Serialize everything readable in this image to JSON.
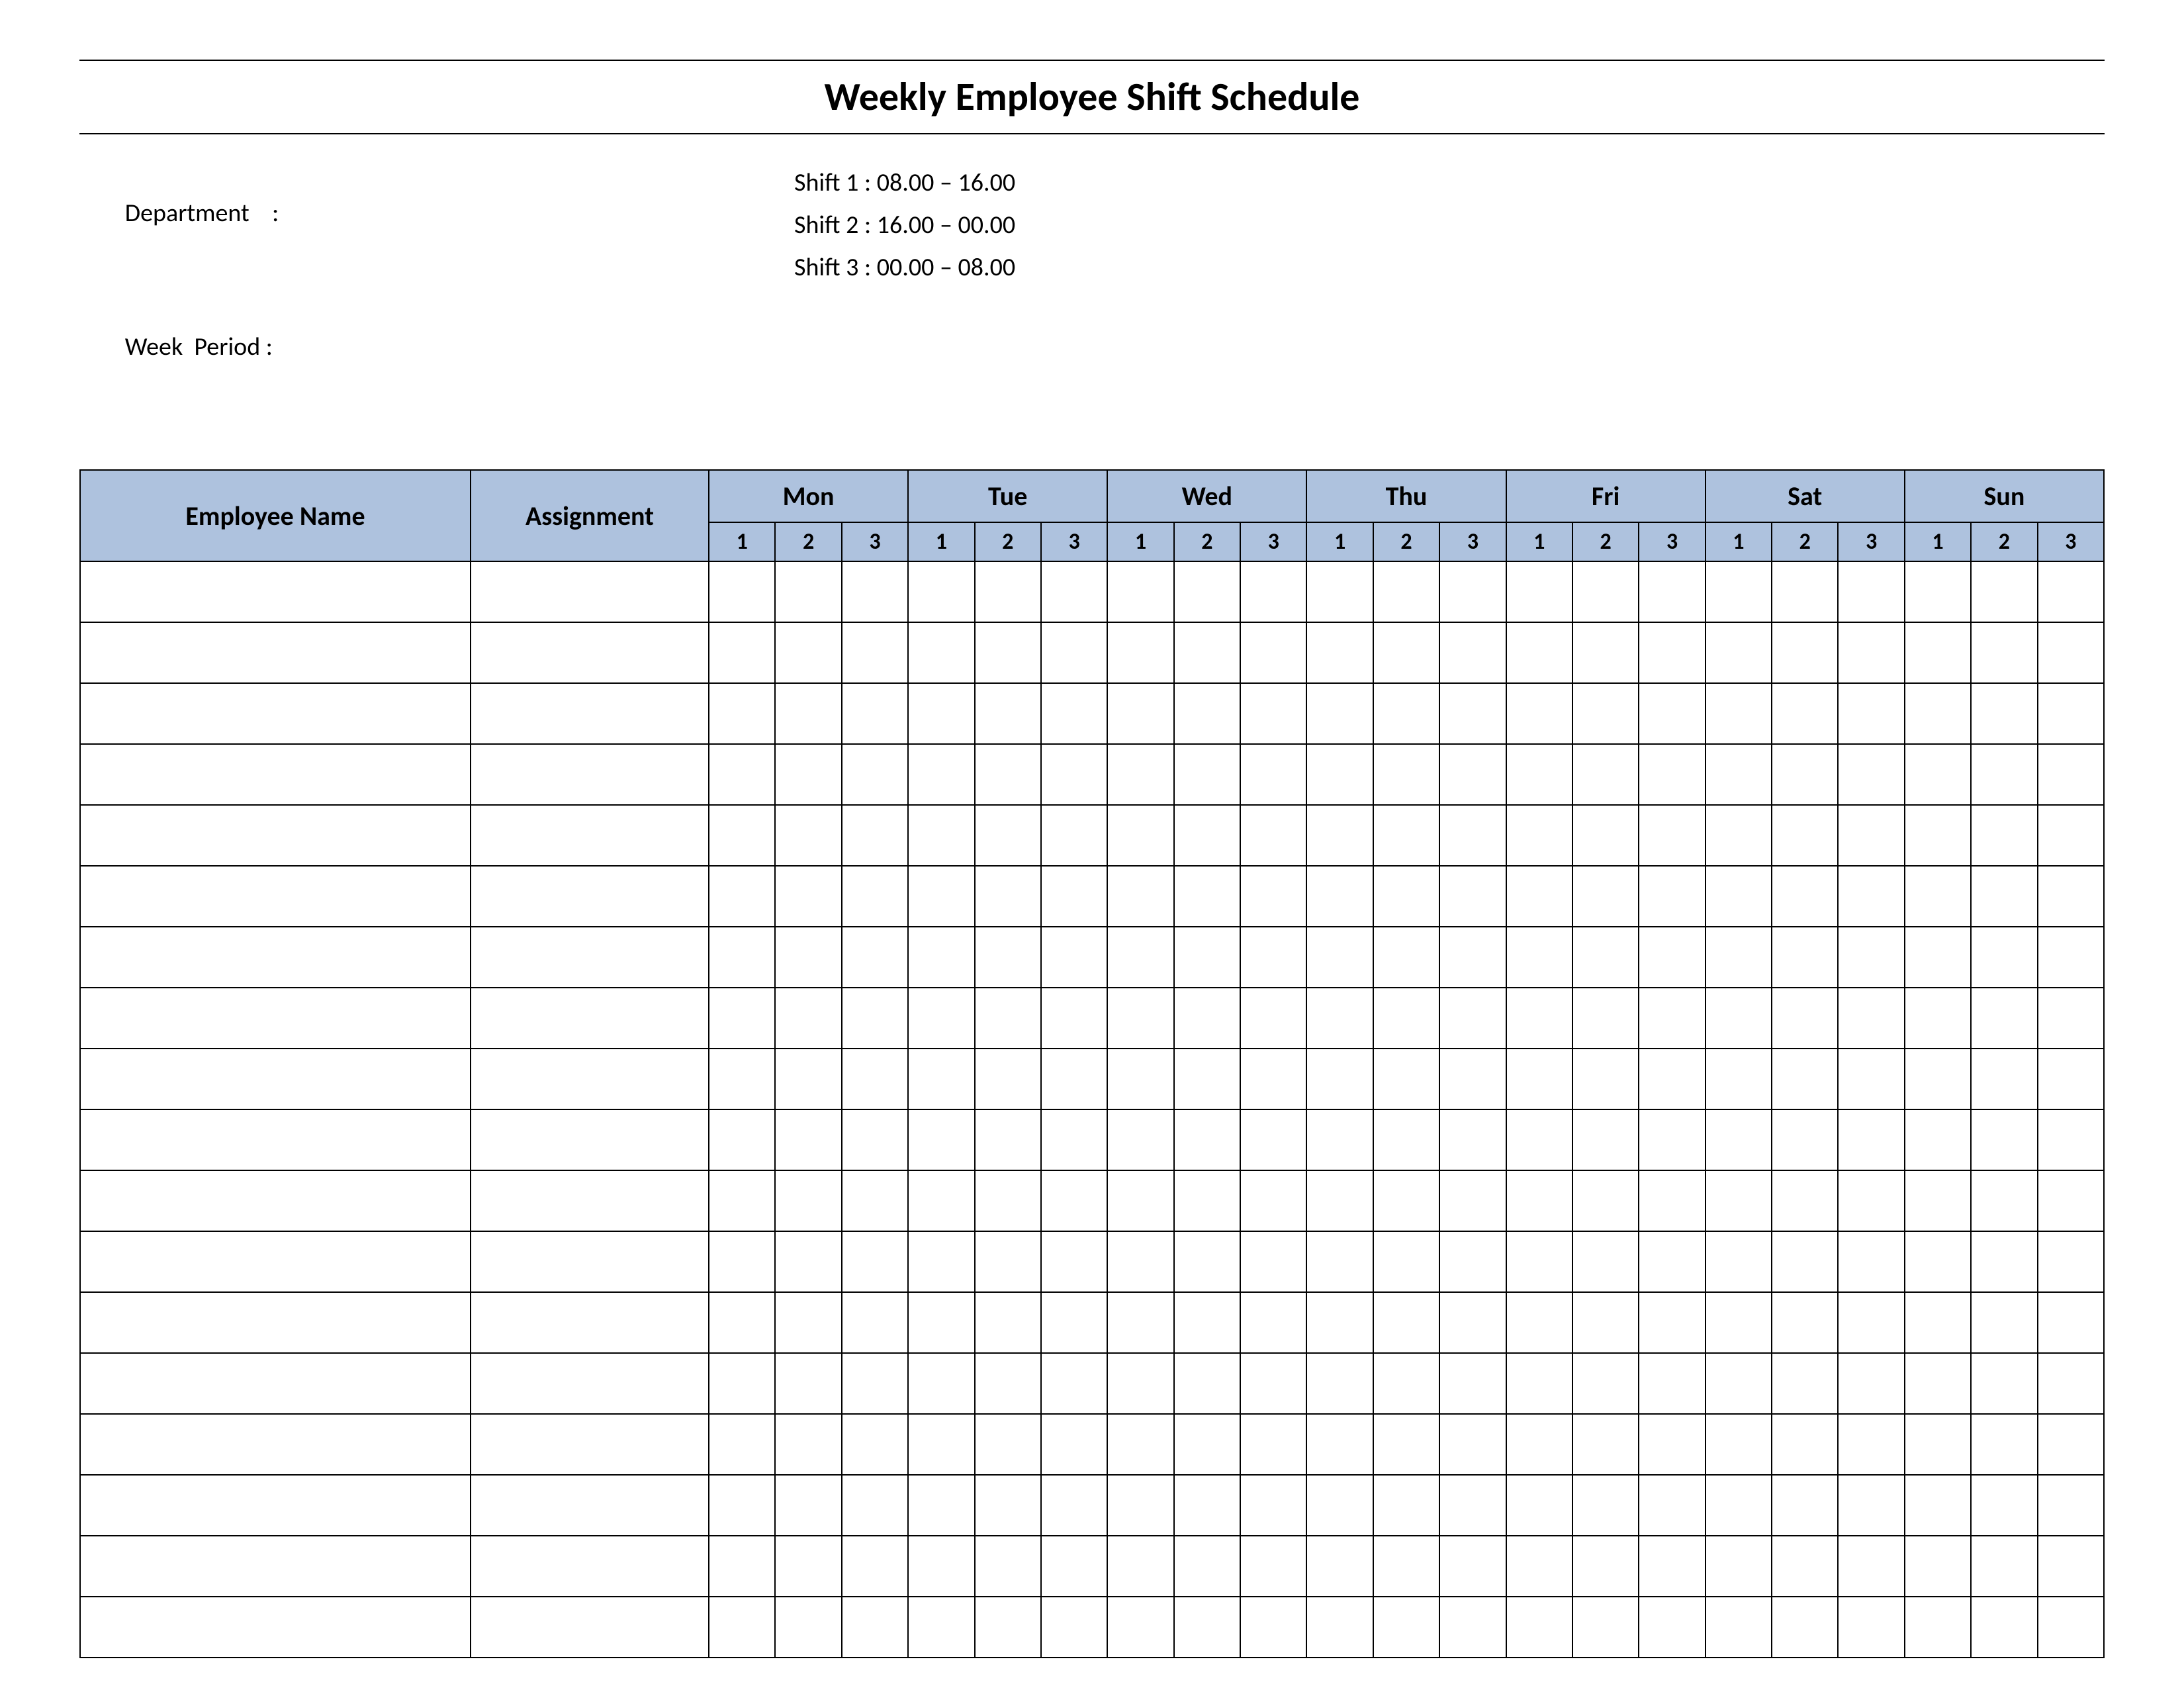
{
  "title": "Weekly Employee Shift Schedule",
  "info": {
    "department_label": "Department    :",
    "department_value": "",
    "week_period_label": "Week  Period :",
    "week_period_value": "",
    "shift1_label": "Shift 1  :",
    "shift1_value": "08.00  – 16.00",
    "shift2_label": "Shift 2  :",
    "shift2_value": "16.00  – 00.00",
    "shift3_label": "Shift 3  :",
    "shift3_value": "00.00  – 08.00"
  },
  "headers": {
    "employee_name": "Employee Name",
    "assignment": "Assignment",
    "days": [
      "Mon",
      "Tue",
      "Wed",
      "Thu",
      "Fri",
      "Sat",
      "Sun"
    ],
    "shift_cols": [
      "1",
      "2",
      "3"
    ]
  },
  "rows": [
    {
      "name": "",
      "assignment": "",
      "shifts": [
        "",
        "",
        "",
        "",
        "",
        "",
        "",
        "",
        "",
        "",
        "",
        "",
        "",
        "",
        "",
        "",
        "",
        "",
        "",
        "",
        ""
      ]
    },
    {
      "name": "",
      "assignment": "",
      "shifts": [
        "",
        "",
        "",
        "",
        "",
        "",
        "",
        "",
        "",
        "",
        "",
        "",
        "",
        "",
        "",
        "",
        "",
        "",
        "",
        "",
        ""
      ]
    },
    {
      "name": "",
      "assignment": "",
      "shifts": [
        "",
        "",
        "",
        "",
        "",
        "",
        "",
        "",
        "",
        "",
        "",
        "",
        "",
        "",
        "",
        "",
        "",
        "",
        "",
        "",
        ""
      ]
    },
    {
      "name": "",
      "assignment": "",
      "shifts": [
        "",
        "",
        "",
        "",
        "",
        "",
        "",
        "",
        "",
        "",
        "",
        "",
        "",
        "",
        "",
        "",
        "",
        "",
        "",
        "",
        ""
      ]
    },
    {
      "name": "",
      "assignment": "",
      "shifts": [
        "",
        "",
        "",
        "",
        "",
        "",
        "",
        "",
        "",
        "",
        "",
        "",
        "",
        "",
        "",
        "",
        "",
        "",
        "",
        "",
        ""
      ]
    },
    {
      "name": "",
      "assignment": "",
      "shifts": [
        "",
        "",
        "",
        "",
        "",
        "",
        "",
        "",
        "",
        "",
        "",
        "",
        "",
        "",
        "",
        "",
        "",
        "",
        "",
        "",
        ""
      ]
    },
    {
      "name": "",
      "assignment": "",
      "shifts": [
        "",
        "",
        "",
        "",
        "",
        "",
        "",
        "",
        "",
        "",
        "",
        "",
        "",
        "",
        "",
        "",
        "",
        "",
        "",
        "",
        ""
      ]
    },
    {
      "name": "",
      "assignment": "",
      "shifts": [
        "",
        "",
        "",
        "",
        "",
        "",
        "",
        "",
        "",
        "",
        "",
        "",
        "",
        "",
        "",
        "",
        "",
        "",
        "",
        "",
        ""
      ]
    },
    {
      "name": "",
      "assignment": "",
      "shifts": [
        "",
        "",
        "",
        "",
        "",
        "",
        "",
        "",
        "",
        "",
        "",
        "",
        "",
        "",
        "",
        "",
        "",
        "",
        "",
        "",
        ""
      ]
    },
    {
      "name": "",
      "assignment": "",
      "shifts": [
        "",
        "",
        "",
        "",
        "",
        "",
        "",
        "",
        "",
        "",
        "",
        "",
        "",
        "",
        "",
        "",
        "",
        "",
        "",
        "",
        ""
      ]
    },
    {
      "name": "",
      "assignment": "",
      "shifts": [
        "",
        "",
        "",
        "",
        "",
        "",
        "",
        "",
        "",
        "",
        "",
        "",
        "",
        "",
        "",
        "",
        "",
        "",
        "",
        "",
        ""
      ]
    },
    {
      "name": "",
      "assignment": "",
      "shifts": [
        "",
        "",
        "",
        "",
        "",
        "",
        "",
        "",
        "",
        "",
        "",
        "",
        "",
        "",
        "",
        "",
        "",
        "",
        "",
        "",
        ""
      ]
    },
    {
      "name": "",
      "assignment": "",
      "shifts": [
        "",
        "",
        "",
        "",
        "",
        "",
        "",
        "",
        "",
        "",
        "",
        "",
        "",
        "",
        "",
        "",
        "",
        "",
        "",
        "",
        ""
      ]
    },
    {
      "name": "",
      "assignment": "",
      "shifts": [
        "",
        "",
        "",
        "",
        "",
        "",
        "",
        "",
        "",
        "",
        "",
        "",
        "",
        "",
        "",
        "",
        "",
        "",
        "",
        "",
        ""
      ]
    },
    {
      "name": "",
      "assignment": "",
      "shifts": [
        "",
        "",
        "",
        "",
        "",
        "",
        "",
        "",
        "",
        "",
        "",
        "",
        "",
        "",
        "",
        "",
        "",
        "",
        "",
        "",
        ""
      ]
    },
    {
      "name": "",
      "assignment": "",
      "shifts": [
        "",
        "",
        "",
        "",
        "",
        "",
        "",
        "",
        "",
        "",
        "",
        "",
        "",
        "",
        "",
        "",
        "",
        "",
        "",
        "",
        ""
      ]
    },
    {
      "name": "",
      "assignment": "",
      "shifts": [
        "",
        "",
        "",
        "",
        "",
        "",
        "",
        "",
        "",
        "",
        "",
        "",
        "",
        "",
        "",
        "",
        "",
        "",
        "",
        "",
        ""
      ]
    },
    {
      "name": "",
      "assignment": "",
      "shifts": [
        "",
        "",
        "",
        "",
        "",
        "",
        "",
        "",
        "",
        "",
        "",
        "",
        "",
        "",
        "",
        "",
        "",
        "",
        "",
        "",
        ""
      ]
    }
  ]
}
